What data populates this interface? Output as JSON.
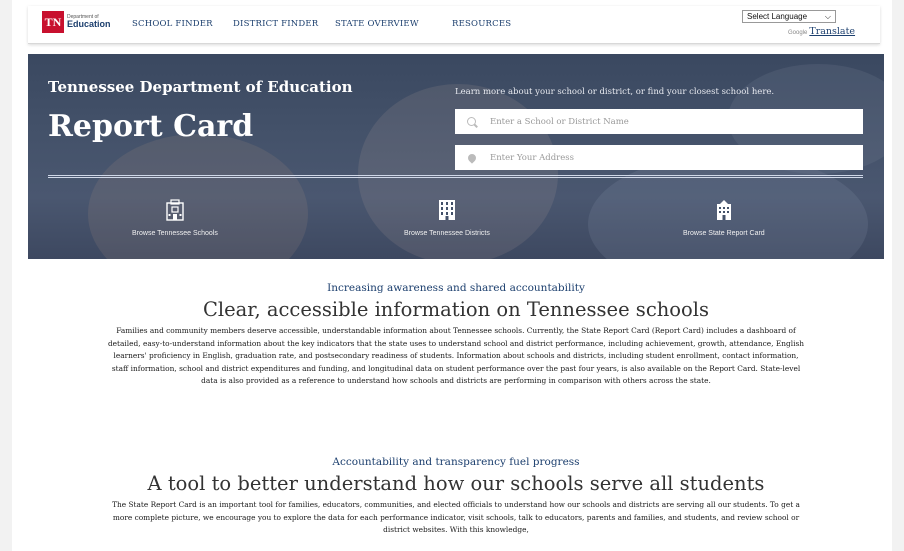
{
  "nav": {
    "logo": {
      "mark": "TN",
      "small": "Department of",
      "big": "Education"
    },
    "links": [
      "SCHOOL FINDER",
      "DISTRICT FINDER",
      "STATE OVERVIEW",
      "RESOURCES"
    ],
    "language_select": "Select Language",
    "google_label": "Google",
    "translate_label": "Translate"
  },
  "hero": {
    "subtitle": "Tennessee Department of Education",
    "title": "Report Card",
    "learn_text": "Learn more about your school or district, or find your closest school here.",
    "search_school_placeholder": "Enter a School or District Name",
    "search_address_placeholder": "Enter Your Address",
    "browse": [
      {
        "label": "Browse Tennessee Schools",
        "icon": "school-building-icon"
      },
      {
        "label": "Browse Tennessee Districts",
        "icon": "district-building-icon"
      },
      {
        "label": "Browse State Report Card",
        "icon": "state-report-icon"
      }
    ]
  },
  "sections": [
    {
      "kicker": "Increasing awareness and shared accountability",
      "heading": "Clear, accessible information on Tennessee schools",
      "body": "Families and community members deserve accessible, understandable information about Tennessee schools. Currently, the State Report Card (Report Card) includes a dashboard of detailed, easy-to-understand information about the key indicators that the state uses to understand school and district performance, including achievement, growth, attendance, English learners' proficiency in English, graduation rate, and postsecondary readiness of students. Information about schools and districts, including student enrollment, contact information, staff information, school and district expenditures and funding, and longitudinal data on student performance over the past four years, is also available on the Report Card. State-level data is also provided as a reference to understand how schools and districts are performing in comparison with others across the state."
    },
    {
      "kicker": "Accountability and transparency fuel progress",
      "heading": "A tool to better understand how our schools serve all students",
      "body": "The State Report Card is an important tool for families, educators, communities, and elected officials to understand how our schools and districts are serving all our students. To get a more complete picture, we encourage you to explore the data for each performance indicator, visit schools, talk to educators, parents and families, and students, and review school or district websites. With this knowledge,"
    }
  ],
  "colors": {
    "brand_navy": "#1c3f6e",
    "brand_red": "#c8102e"
  }
}
